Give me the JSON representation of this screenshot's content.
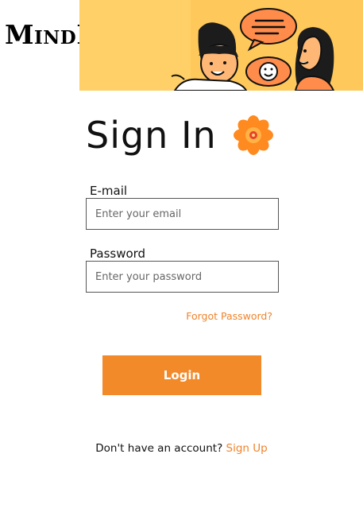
{
  "brand": {
    "logo_text": "MindEase"
  },
  "banner": {
    "illustration": "two-people-chatting-illustration",
    "background_color": "#ffc85a"
  },
  "form": {
    "title": "Sign In",
    "title_icon": "flower-icon",
    "email_label": "E-mail",
    "email_placeholder": "Enter your email",
    "password_label": "Password",
    "password_placeholder": "Enter your password",
    "forgot_link": "Forgot Password?",
    "login_button": "Login"
  },
  "footer": {
    "prompt": "Don't have an account?",
    "signup_link": "Sign Up"
  },
  "colors": {
    "accent": "#f28a2a",
    "link": "#f0832a",
    "text": "#111111"
  }
}
